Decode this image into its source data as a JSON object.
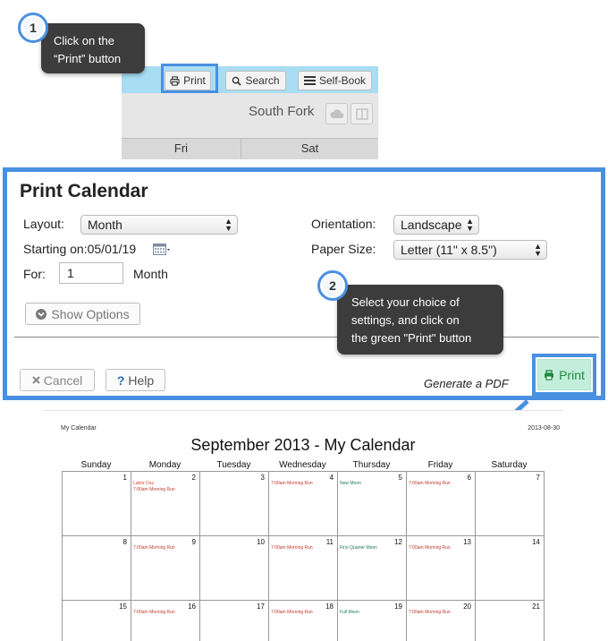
{
  "callout1": {
    "step": "1",
    "line1": "Click on the",
    "line2": "“Print” button"
  },
  "callout2": {
    "step": "2",
    "line1": "Select your choice of",
    "line2": "settings, and click on",
    "line3": "the green \"Print\" button"
  },
  "toolbar": {
    "print_label": "Print",
    "search_label": "Search",
    "selfbook_label": "Self-Book",
    "location": "South Fork",
    "day_fri": "Fri",
    "day_sat": "Sat"
  },
  "dialog": {
    "title": "Print Calendar",
    "layout_label": "Layout:",
    "layout_value": "Month",
    "starting_label": "Starting on:",
    "starting_value": "05/01/19",
    "for_label": "For:",
    "for_value": "1",
    "for_unit": "Month",
    "show_options": "Show Options",
    "orientation_label": "Orientation:",
    "orientation_value": "Landscape",
    "paper_label": "Paper Size:",
    "paper_value": "Letter (11\" x 8.5\")",
    "cancel_label": "Cancel",
    "help_label": "Help",
    "generate_pdf": "Generate a PDF",
    "print_label": "Print"
  },
  "preview": {
    "header_left": "My Calendar",
    "header_right": "2013-08-30",
    "title": "September 2013 - My Calendar",
    "weekdays": [
      "Sunday",
      "Monday",
      "Tuesday",
      "Wednesday",
      "Thursday",
      "Friday",
      "Saturday"
    ],
    "weeks": [
      {
        "days": [
          "1",
          "2",
          "3",
          "4",
          "5",
          "6",
          "7"
        ]
      },
      {
        "days": [
          "8",
          "9",
          "10",
          "11",
          "12",
          "13",
          "14"
        ]
      },
      {
        "days": [
          "15",
          "16",
          "17",
          "18",
          "19",
          "20",
          "21"
        ]
      }
    ],
    "events": [
      {
        "week": 0,
        "day": 1,
        "line": 0,
        "text": "Labor Day",
        "color": "#e0463a"
      },
      {
        "week": 0,
        "day": 1,
        "line": 1,
        "text": "7:00am Morning Run",
        "color": "#c0392b"
      },
      {
        "week": 0,
        "day": 3,
        "line": 0,
        "text": "7:00am Morning Run",
        "color": "#c0392b"
      },
      {
        "week": 0,
        "day": 4,
        "line": 0,
        "text": "New Moon",
        "color": "#1e7a5a"
      },
      {
        "week": 0,
        "day": 5,
        "line": 0,
        "text": "7:00am Morning Run",
        "color": "#c0392b"
      },
      {
        "week": 1,
        "day": 1,
        "line": 0,
        "text": "7:00am Morning Run",
        "color": "#c0392b"
      },
      {
        "week": 1,
        "day": 3,
        "line": 0,
        "text": "7:00am Morning Run",
        "color": "#c0392b"
      },
      {
        "week": 1,
        "day": 4,
        "line": 0,
        "text": "First Quarter Moon",
        "color": "#1e7a5a"
      },
      {
        "week": 1,
        "day": 5,
        "line": 0,
        "text": "7:00am Morning Run",
        "color": "#c0392b"
      },
      {
        "week": 2,
        "day": 1,
        "line": 0,
        "text": "7:00am Morning Run",
        "color": "#c0392b"
      },
      {
        "week": 2,
        "day": 3,
        "line": 0,
        "text": "7:00am Morning Run",
        "color": "#c0392b"
      },
      {
        "week": 2,
        "day": 4,
        "line": 0,
        "text": "Full Moon",
        "color": "#1e7a5a"
      },
      {
        "week": 2,
        "day": 5,
        "line": 0,
        "text": "7:00am Morning Run",
        "color": "#c0392b"
      }
    ]
  },
  "colors": {
    "accent": "#4a90e2",
    "print_green": "#1f8a3e",
    "print_bg": "#c4eedc",
    "toolbar_blue": "#a9ddf3"
  },
  "icons": [
    "printer-icon",
    "search-icon",
    "list-icon",
    "cloud-icon",
    "panel-icon",
    "calendar-icon",
    "chevron-circle-icon",
    "close-icon",
    "question-icon"
  ]
}
